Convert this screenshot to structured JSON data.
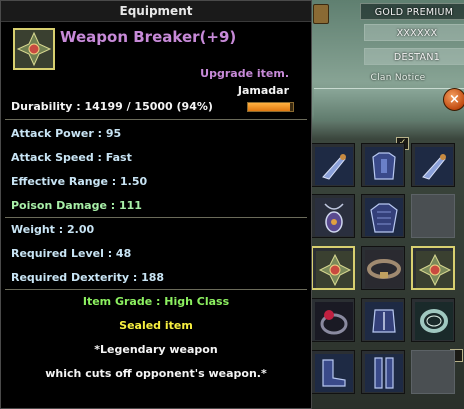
{
  "tooltip": {
    "header": "Equipment",
    "item_name": "Weapon Breaker(+9)",
    "upgrade": "Upgrade item.",
    "class_name": "Jamadar",
    "durability": "Durability : 14199 / 15000 (94%)",
    "durability_level": 0.94,
    "stats": [
      "Attack Power : 95",
      "Attack Speed : Fast",
      "Effective Range : 1.50",
      "Poison Damage : 111",
      "Weight : 2.00",
      "Required Level : 48",
      "Required Dexterity : 188"
    ],
    "grade": "Item Grade : High Class",
    "sealed": "Sealed item",
    "desc_line1": "*Legendary weapon",
    "desc_line2": "which cuts off opponent's weapon.*",
    "colors": {
      "name": "#c78ad8",
      "stat": "#c8e4f4",
      "poison": "#a8f0a8",
      "grade": "#8cf060",
      "sealed": "#f8f040"
    }
  },
  "side_panel": {
    "premium": "GOLD PREMIUM",
    "username": "XXXXXX",
    "character": "DESTAN1",
    "clan_notice": "Clan Notice",
    "close_glyph": "×",
    "check_glyph": "✓"
  },
  "inventory": [
    {
      "icon": "dagger-icon"
    },
    {
      "icon": "armor-icon"
    },
    {
      "icon": "dagger-icon"
    },
    {
      "icon": "amulet-icon"
    },
    {
      "icon": "armor-icon"
    },
    {
      "icon": "empty-slot"
    },
    {
      "icon": "weapon-breaker-icon"
    },
    {
      "icon": "belt-icon"
    },
    {
      "icon": "weapon-breaker-icon"
    },
    {
      "icon": "ring-icon"
    },
    {
      "icon": "gauntlet-icon"
    },
    {
      "icon": "ring-icon"
    },
    {
      "icon": "boots-icon"
    },
    {
      "icon": "leg-armor-icon"
    },
    {
      "icon": "empty-slot"
    }
  ]
}
